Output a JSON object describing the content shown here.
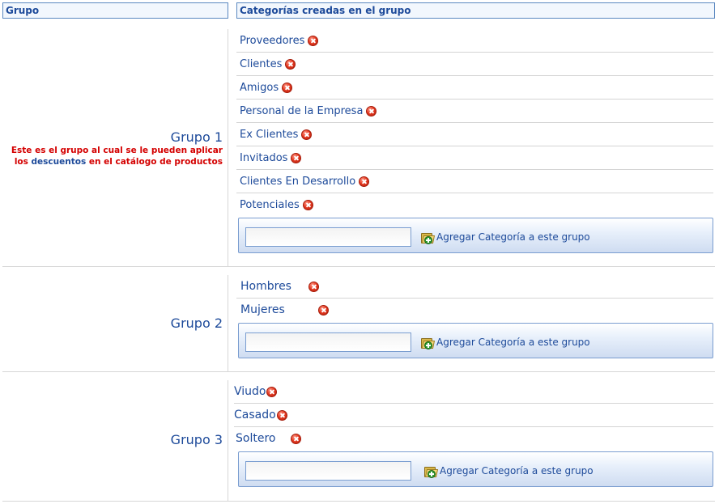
{
  "header": {
    "group_col": "Grupo",
    "categories_col": "Categorías creadas en el grupo"
  },
  "groups": [
    {
      "title": "Grupo 1",
      "note": {
        "part1": "Este es el grupo al cual se le pueden aplicar los ",
        "link": "descuentos",
        "part2": " en el catálogo de productos"
      },
      "categories": [
        {
          "label": "Proveedores"
        },
        {
          "label": "Clientes"
        },
        {
          "label": "Amigos"
        },
        {
          "label": "Personal de la Empresa"
        },
        {
          "label": "Ex Clientes"
        },
        {
          "label": "Invitados"
        },
        {
          "label": "Clientes En Desarrollo"
        },
        {
          "label": "Potenciales"
        }
      ],
      "add_input_value": "",
      "add_button_label": "Agregar Categoría a este grupo"
    },
    {
      "title": "Grupo 2",
      "categories": [
        {
          "label": "Hombres"
        },
        {
          "label": "Mujeres"
        }
      ],
      "add_input_value": "",
      "add_button_label": "Agregar Categoría a este grupo"
    },
    {
      "title": "Grupo 3",
      "categories": [
        {
          "label": "Viudo"
        },
        {
          "label": "Casado"
        },
        {
          "label": "Soltero"
        }
      ],
      "add_input_value": "",
      "add_button_label": "Agregar Categoría a este grupo"
    }
  ],
  "icons": {
    "delete": "delete-circle-x-icon",
    "add": "folder-add-icon"
  },
  "colors": {
    "header_text": "#1d4a9a",
    "note_red": "#d40000",
    "link_blue": "#1d4a9a",
    "delete_red": "#e53a22"
  }
}
